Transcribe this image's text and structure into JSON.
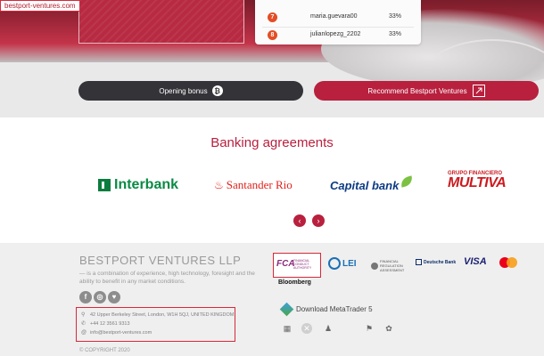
{
  "url_tag": "bestport-ventures.com",
  "ranking": [
    {
      "rank": "7",
      "user": "maria.guevara00",
      "percent": "33%"
    },
    {
      "rank": "8",
      "user": "julianlopezg_2202",
      "percent": "33%"
    }
  ],
  "buttons": {
    "bonus_label": "Opening bonus",
    "bonus_icon": "₿",
    "recommend_label": "Recommend Bestport Ventures"
  },
  "banking": {
    "title": "Banking agreements",
    "logos": {
      "interbank": "Interbank",
      "santander": "Santander Rio",
      "capital": "Capital bank",
      "multiva_small": "GRUPO FINANCIERO",
      "multiva": "MULTIVA"
    },
    "prev": "‹",
    "next": "›"
  },
  "footer": {
    "company": "BESTPORT VENTURES LLP",
    "description": "— is a combination of experience, high technology, foresight and the ability to benefit in any market conditions.",
    "social": [
      "f",
      "◎",
      "♥"
    ],
    "address": "42 Upper Berkeley Street, London, W1H 5QJ, UNITED KINGDOM",
    "phone": "+44 12 3561 9313",
    "email": "info@bestport-ventures.com",
    "copyright": "© COPYRIGHT 2020",
    "download_label": "Download MetaTrader 5",
    "platforms": [
      "▦",
      "✕",
      "♟",
      "",
      "⚑",
      "✿"
    ]
  },
  "partners": {
    "fca": "FCA",
    "fca_sub": "FINANCIAL CONDUCT AUTHORITY",
    "bloomberg": "Bloomberg",
    "lei": "LEI",
    "financial_reg": "FINANCIAL REGULATION ASSESSMENT",
    "deutsche": "Deutsche Bank",
    "visa": "VISA"
  },
  "colors": {
    "accent": "#b8203e",
    "dark_button": "#333338",
    "footer_bg": "#efefef"
  }
}
